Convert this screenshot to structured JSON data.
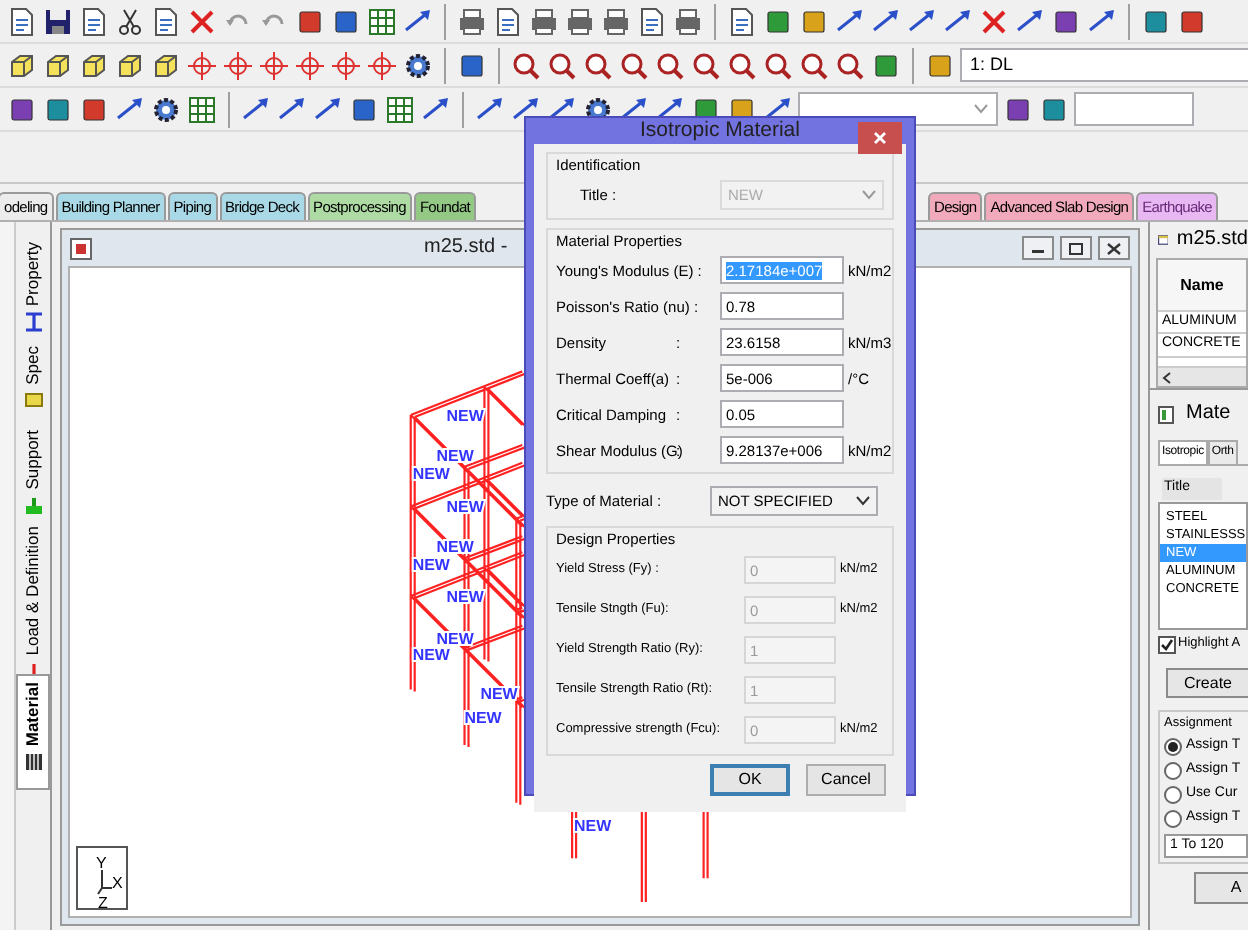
{
  "toolbar": {
    "load_case": "1: DL"
  },
  "module_tabs": [
    {
      "label": "odeling",
      "color": "#ececec",
      "selected": false
    },
    {
      "label": "Building Planner",
      "color": "#a9d9e6",
      "selected": false
    },
    {
      "label": "Piping",
      "color": "#a9d9e6",
      "selected": false
    },
    {
      "label": "Bridge Deck",
      "color": "#a9d9e6",
      "selected": false
    },
    {
      "label": "Postprocessing",
      "color": "#aedba4",
      "selected": false
    },
    {
      "label": "Foundat",
      "color": "#94c985",
      "selected": false
    },
    {
      "label": "Design",
      "color": "#f1aabb",
      "selected": false
    },
    {
      "label": "Advanced Slab Design",
      "color": "#f1aabb",
      "selected": false
    },
    {
      "label": "Earthquake",
      "color": "#e8b8f2",
      "selected": false
    }
  ],
  "side_tabs": [
    {
      "label": "Property",
      "kind": "section",
      "selected": false
    },
    {
      "label": "Spec",
      "kind": "spec",
      "selected": false
    },
    {
      "label": "Support",
      "kind": "support",
      "selected": false
    },
    {
      "label": "Load & Definition",
      "kind": "load",
      "selected": false
    },
    {
      "label": "Material",
      "kind": "material",
      "selected": true
    }
  ],
  "document_window": {
    "title": "m25.std -",
    "member_labels": [
      "NEW",
      "NEW",
      "NEW",
      "NEW",
      "NEW",
      "NEW",
      "NEW",
      "NEW",
      "NEW",
      "NEW",
      "NEW",
      "NEW"
    ],
    "axes": [
      "Y",
      "X",
      "Z"
    ]
  },
  "dialog": {
    "title": "Isotropic Material",
    "identification": {
      "heading": "Identification",
      "label": "Title :",
      "value": "NEW",
      "disabled": true
    },
    "material_properties": {
      "heading": "Material Properties",
      "rows": [
        {
          "label": "Young's Modulus (E) :",
          "value": "2.17184e+007",
          "unit": "kN/m2",
          "highlighted": true
        },
        {
          "label": "Poisson's Ratio (nu)  :",
          "value": "0.78",
          "highlighted": false
        },
        {
          "label": "Density",
          "colon": ":",
          "value": "23.6158",
          "unit": "kN/m3",
          "highlighted": false
        },
        {
          "label": "Thermal Coeff(a)",
          "colon": ":",
          "value": "5e-006",
          "unit": "/°C",
          "highlighted": false
        },
        {
          "label": "Critical Damping",
          "colon": ":",
          "value": "0.05",
          "highlighted": false
        },
        {
          "label": "Shear Modulus (G)",
          "colon": ":",
          "value": "9.28137e+006",
          "unit": "kN/m2",
          "highlighted": false
        }
      ]
    },
    "type": {
      "label": "Type of Material :",
      "value": "NOT SPECIFIED"
    },
    "design_properties": {
      "heading": "Design Properties",
      "rows": [
        {
          "label": "Yield Stress (Fy) :",
          "value": "0",
          "unit": "kN/m2",
          "disabled": true
        },
        {
          "label": "Tensile Stngth (Fu):",
          "value": "0",
          "unit": "kN/m2",
          "disabled": true
        },
        {
          "label": "Yield Strength Ratio (Ry):",
          "value": "1",
          "disabled": true
        },
        {
          "label": "Tensile Strength Ratio (Rt):",
          "value": "1",
          "disabled": true
        },
        {
          "label": "Compressive strength (Fcu):",
          "value": "0",
          "unit": "kN/m2",
          "disabled": true
        }
      ]
    },
    "buttons": [
      {
        "label": "OK",
        "default": true
      },
      {
        "label": "Cancel",
        "default": false
      }
    ]
  },
  "table_window": {
    "title": "m25.std",
    "column": "Name",
    "rows": [
      "ALUMINUM",
      "CONCRETE"
    ]
  },
  "material_panel": {
    "title": "Mate",
    "tabs": [
      {
        "label": "Isotropic",
        "selected": true
      },
      {
        "label": "Orth",
        "selected": false
      }
    ],
    "list_header": "Title",
    "items": [
      {
        "label": "STEEL",
        "selected": false
      },
      {
        "label": "STAINLESSS",
        "selected": false
      },
      {
        "label": "NEW",
        "selected": true
      },
      {
        "label": "ALUMINUM",
        "selected": false
      },
      {
        "label": "CONCRETE",
        "selected": false
      }
    ],
    "highlight": {
      "label": "Highlight A",
      "checked": true
    },
    "create_button": "Create",
    "assignment": {
      "title": "Assignment",
      "options": [
        {
          "label": "Assign T",
          "selected": true
        },
        {
          "label": "Assign T",
          "selected": false
        },
        {
          "label": "Use Cur",
          "selected": false
        },
        {
          "label": "Assign T",
          "selected": false
        }
      ],
      "range": "1 To 120"
    },
    "apply_button": "A"
  }
}
